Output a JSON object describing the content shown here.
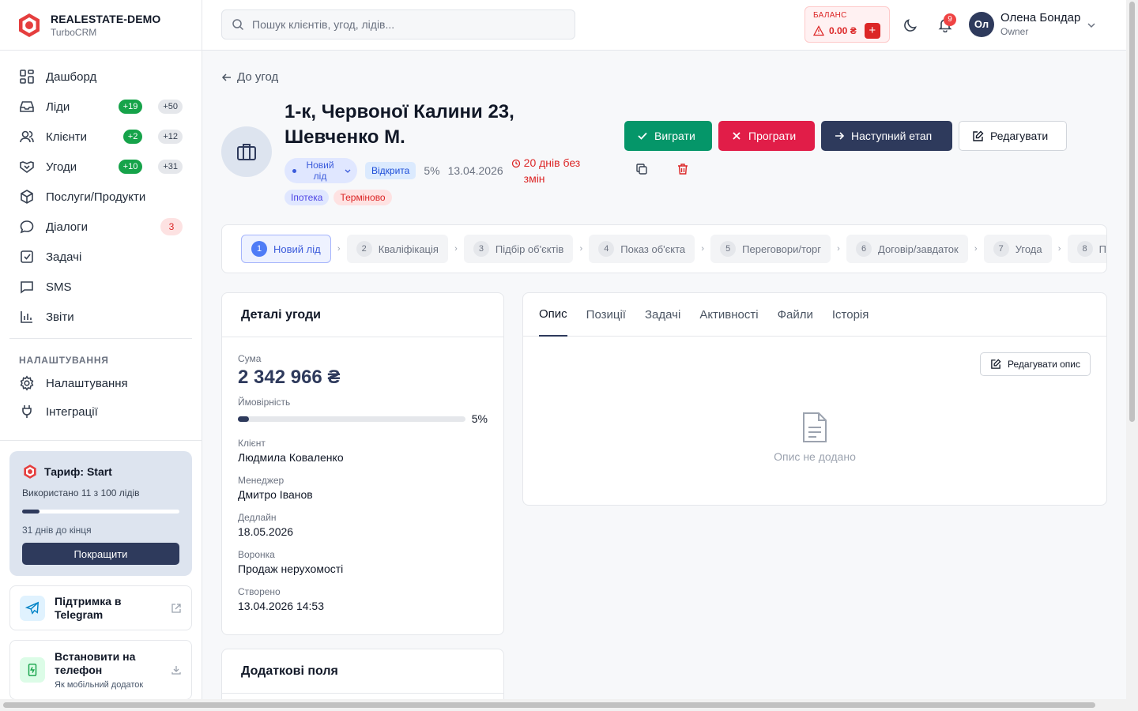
{
  "brand": {
    "name": "REALESTATE-DEMO",
    "sub": "TurboCRM"
  },
  "nav": {
    "items": [
      {
        "label": "Дашборд"
      },
      {
        "label": "Ліди",
        "badge_new": "+19",
        "badge_total": "+50"
      },
      {
        "label": "Клієнти",
        "badge_new": "+2",
        "badge_total": "+12"
      },
      {
        "label": "Угоди",
        "badge_new": "+10",
        "badge_total": "+31"
      },
      {
        "label": "Послуги/Продукти"
      },
      {
        "label": "Діалоги",
        "badge_count": "3"
      },
      {
        "label": "Задачі"
      },
      {
        "label": "SMS"
      },
      {
        "label": "Звіти"
      }
    ],
    "section_title": "НАЛАШТУВАННЯ",
    "settings": [
      {
        "label": "Налаштування"
      },
      {
        "label": "Інтеграції"
      }
    ]
  },
  "plan": {
    "title": "Тариф: Start",
    "used": "Використано 11 з 100 лідів",
    "used_fraction": 0.11,
    "days": "31 днів до кінця",
    "upgrade": "Покращити"
  },
  "support": {
    "title": "Підтримка в Telegram"
  },
  "install": {
    "title": "Встановити на телефон",
    "sub": "Як мобільний додаток"
  },
  "search": {
    "placeholder": "Пошук клієнтів, угод, лідів..."
  },
  "balance": {
    "label": "БАЛАНС",
    "value": "0.00 ₴",
    "plus": "+"
  },
  "notifications": {
    "count": "9"
  },
  "user": {
    "initials": "Ол",
    "name": "Олена Бондар",
    "role": "Owner"
  },
  "deal": {
    "back": "До угод",
    "title": "1-к, Червоної Калини 23, Шевченко М.",
    "stage": "Новий лід",
    "status": "Відкрита",
    "probability": "5%",
    "date": "13.04.2026",
    "stale": "20 днів без змін",
    "tags": [
      "Іпотека",
      "Терміново"
    ]
  },
  "actions": {
    "win": "Виграти",
    "lose": "Програти",
    "next": "Наступний етап",
    "edit": "Редагувати"
  },
  "pipeline": {
    "stages": [
      {
        "n": "1",
        "label": "Новий лід"
      },
      {
        "n": "2",
        "label": "Кваліфікація"
      },
      {
        "n": "3",
        "label": "Підбір об'єктів"
      },
      {
        "n": "4",
        "label": "Показ об'єкта"
      },
      {
        "n": "5",
        "label": "Переговори/торг"
      },
      {
        "n": "6",
        "label": "Договір/завдаток"
      },
      {
        "n": "7",
        "label": "Угода"
      },
      {
        "n": "8",
        "label": "Програно"
      }
    ]
  },
  "details": {
    "title": "Деталі угоди",
    "sum_label": "Сума",
    "sum": "2 342 966 ₴",
    "prob_label": "Ймовірність",
    "prob": "5%",
    "prob_fraction": 0.05,
    "client_label": "Клієнт",
    "client": "Людмила Коваленко",
    "manager_label": "Менеджер",
    "manager": "Дмитро Іванов",
    "deadline_label": "Дедлайн",
    "deadline": "18.05.2026",
    "funnel_label": "Воронка",
    "funnel": "Продаж нерухомості",
    "created_label": "Створено",
    "created": "13.04.2026 14:53"
  },
  "extra": {
    "title": "Додаткові поля"
  },
  "tabs": [
    "Опис",
    "Позиції",
    "Задачі",
    "Активності",
    "Файли",
    "Історія"
  ],
  "desc": {
    "edit": "Редагувати опис",
    "empty": "Опис не додано"
  }
}
